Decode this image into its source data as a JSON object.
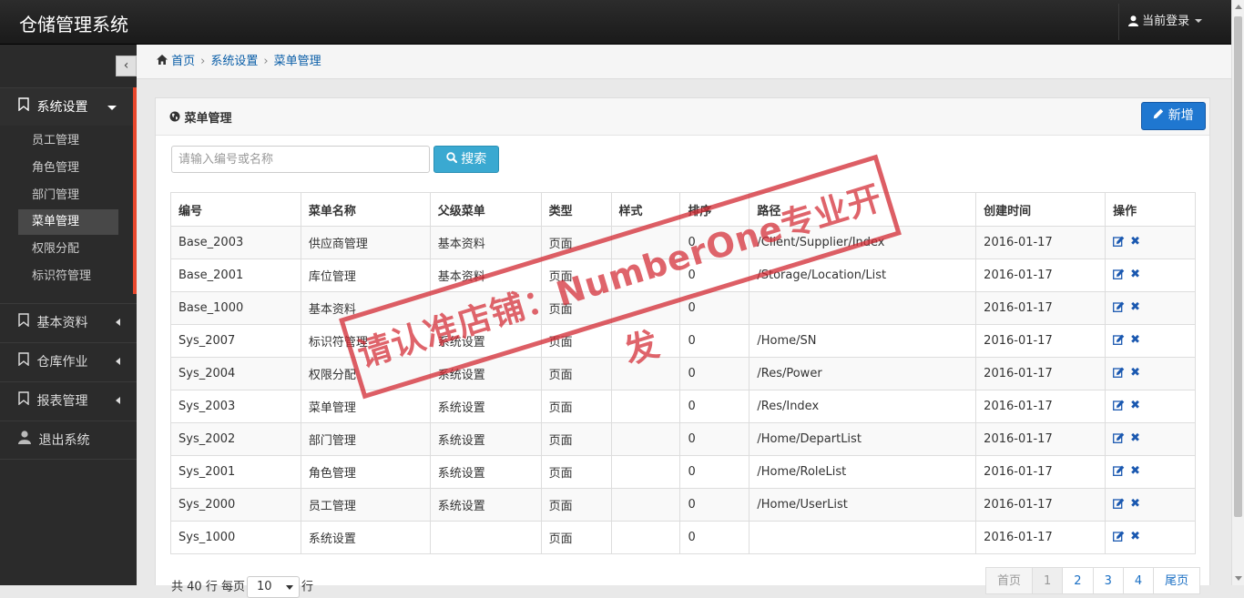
{
  "app": {
    "title": "仓储管理系统",
    "user_label": "当前登录"
  },
  "sidebar": {
    "items": [
      {
        "label": "系统设置",
        "icon": "bookmark-icon",
        "expanded": true
      },
      {
        "label": "基本资料",
        "icon": "bookmark-icon"
      },
      {
        "label": "仓库作业",
        "icon": "bookmark-icon"
      },
      {
        "label": "报表管理",
        "icon": "bookmark-icon"
      },
      {
        "label": "退出系统",
        "icon": "user-icon"
      }
    ],
    "submenu": [
      "员工管理",
      "角色管理",
      "部门管理",
      "菜单管理",
      "权限分配",
      "标识符管理"
    ],
    "active_submenu": "菜单管理"
  },
  "breadcrumb": [
    "首页",
    "系统设置",
    "菜单管理"
  ],
  "panel": {
    "title": "菜单管理",
    "new_button": "新增"
  },
  "search": {
    "placeholder": "请输入编号或名称",
    "button": "搜索"
  },
  "table": {
    "columns": [
      "编号",
      "菜单名称",
      "父级菜单",
      "类型",
      "样式",
      "排序",
      "路径",
      "创建时间",
      "操作"
    ],
    "rows": [
      [
        "Base_2003",
        "供应商管理",
        "基本资料",
        "页面",
        "",
        "0",
        "/Client/Supplier/Index",
        "2016-01-17"
      ],
      [
        "Base_2001",
        "库位管理",
        "基本资料",
        "页面",
        "",
        "0",
        "/Storage/Location/List",
        "2016-01-17"
      ],
      [
        "Base_1000",
        "基本资料",
        "",
        "页面",
        "",
        "0",
        "",
        "2016-01-17"
      ],
      [
        "Sys_2007",
        "标识符管理",
        "系统设置",
        "页面",
        "",
        "0",
        "/Home/SN",
        "2016-01-17"
      ],
      [
        "Sys_2004",
        "权限分配",
        "系统设置",
        "页面",
        "",
        "0",
        "/Res/Power",
        "2016-01-17"
      ],
      [
        "Sys_2003",
        "菜单管理",
        "系统设置",
        "页面",
        "",
        "0",
        "/Res/Index",
        "2016-01-17"
      ],
      [
        "Sys_2002",
        "部门管理",
        "系统设置",
        "页面",
        "",
        "0",
        "/Home/DepartList",
        "2016-01-17"
      ],
      [
        "Sys_2001",
        "角色管理",
        "系统设置",
        "页面",
        "",
        "0",
        "/Home/RoleList",
        "2016-01-17"
      ],
      [
        "Sys_2000",
        "员工管理",
        "系统设置",
        "页面",
        "",
        "0",
        "/Home/UserList",
        "2016-01-17"
      ],
      [
        "Sys_1000",
        "系统设置",
        "",
        "页面",
        "",
        "0",
        "",
        "2016-01-17"
      ]
    ]
  },
  "footer": {
    "total_prefix": "共",
    "total": "40",
    "total_unit": "行",
    "per_page_prefix": "每页",
    "page_size": "10",
    "per_page_suffix": "行"
  },
  "pagination": [
    "首页",
    "1",
    "2",
    "3",
    "4",
    "尾页"
  ],
  "watermark": "请认准店铺：NumberOne专业开发",
  "colors": {
    "accent": "#e8472c",
    "primary": "#1f77d0",
    "info": "#3aa9d1",
    "link": "#0a5ea8"
  }
}
